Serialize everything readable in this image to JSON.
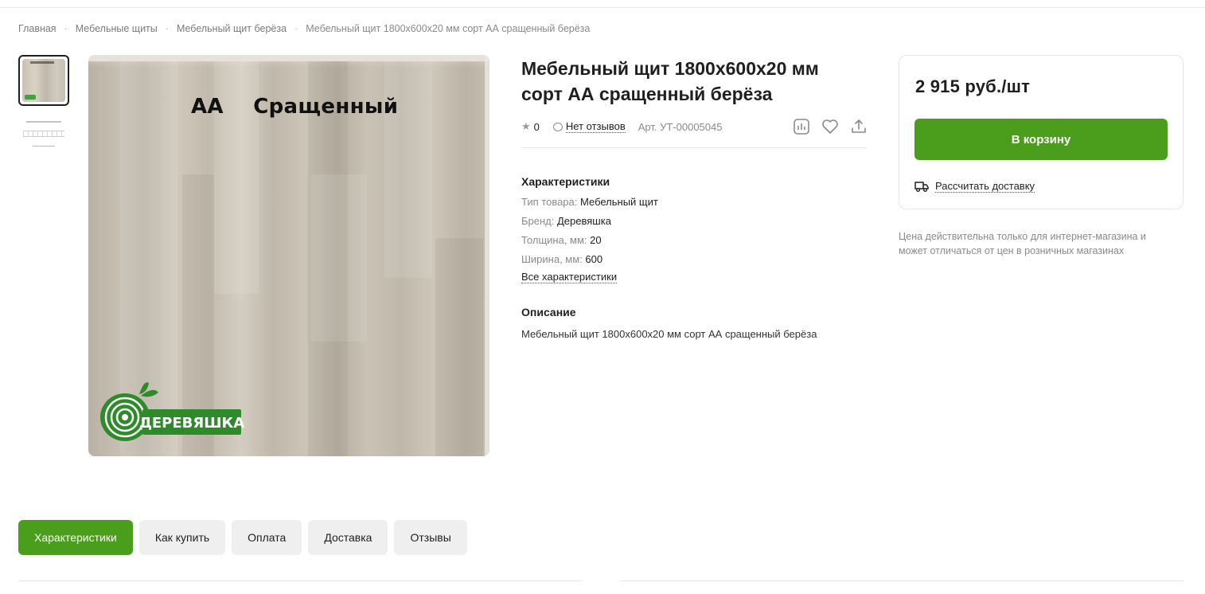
{
  "breadcrumb": {
    "items": [
      "Главная",
      "Мебельные щиты",
      "Мебельный щит берёза",
      "Мебельный щит 1800х600х20 мм сорт АА сращенный берёза"
    ],
    "separator": "·"
  },
  "gallery": {
    "photo_caption": "АА    Сращенный",
    "logo_text": "ДЕРЕВЯШКА"
  },
  "product": {
    "title": "Мебельный щит 1800х600х20 мм сорт АА сращенный берёза",
    "rating": "0",
    "reviews_label": "Нет отзывов",
    "article": "Арт. УТ-00005045",
    "actions": [
      "compare-icon",
      "heart-icon",
      "share-icon"
    ]
  },
  "specs": {
    "heading": "Характеристики",
    "rows": [
      {
        "key": "Тип товара:",
        "value": "Мебельный щит"
      },
      {
        "key": "Бренд:",
        "value": "Деревяшка"
      },
      {
        "key": "Толщина, мм:",
        "value": "20"
      },
      {
        "key": "Ширина, мм:",
        "value": "600"
      }
    ],
    "all_link": "Все характеристики"
  },
  "description": {
    "heading": "Описание",
    "text": "Мебельный щит 1800х600х20 мм сорт АА сращенный берёза"
  },
  "buybox": {
    "price": "2 915 руб./шт",
    "cart_label": "В корзину",
    "delivery_label": "Рассчитать доставку",
    "note": "Цена действительна только для интернет-магазина и может отличаться от цен в розничных магазинах"
  },
  "tabs": [
    {
      "label": "Характеристики",
      "active": true
    },
    {
      "label": "Как купить",
      "active": false
    },
    {
      "label": "Оплата",
      "active": false
    },
    {
      "label": "Доставка",
      "active": false
    },
    {
      "label": "Отзывы",
      "active": false
    }
  ],
  "colors": {
    "accent": "#4a9e1c",
    "muted_text": "#8a8a8a",
    "tab_bg": "#efefef"
  }
}
